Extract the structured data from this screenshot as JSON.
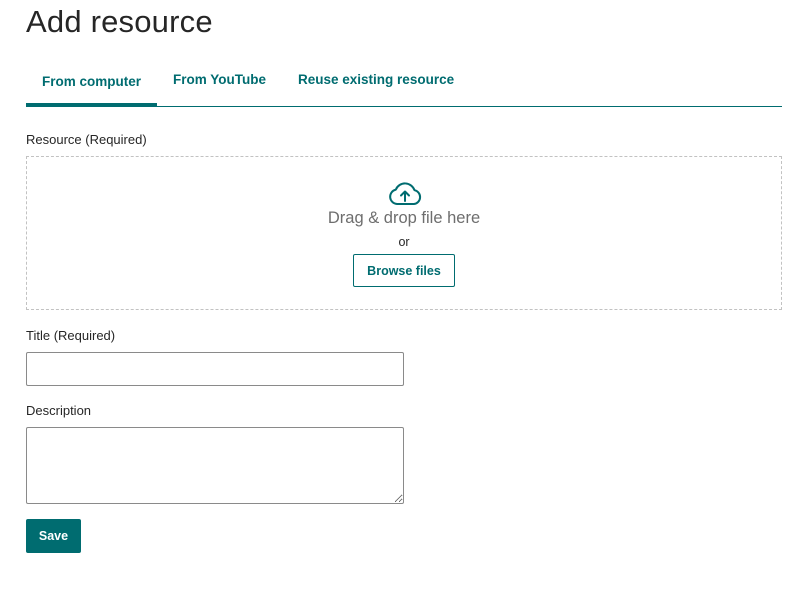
{
  "page": {
    "title": "Add resource"
  },
  "tabs": [
    {
      "label": "From computer",
      "active": true
    },
    {
      "label": "From YouTube",
      "active": false
    },
    {
      "label": "Reuse existing resource",
      "active": false
    }
  ],
  "resource": {
    "label": "Resource (Required)",
    "dropzone": {
      "icon": "cloud-upload-icon",
      "drag_text": "Drag & drop file here",
      "or_text": "or",
      "browse_label": "Browse files"
    }
  },
  "title_field": {
    "label": "Title (Required)",
    "value": "",
    "placeholder": ""
  },
  "description_field": {
    "label": "Description",
    "value": "",
    "placeholder": ""
  },
  "actions": {
    "save_label": "Save"
  },
  "colors": {
    "accent": "#006c70",
    "text": "#262626",
    "muted_text": "#6e6e6e",
    "dropzone_border": "#c2c2c2"
  }
}
